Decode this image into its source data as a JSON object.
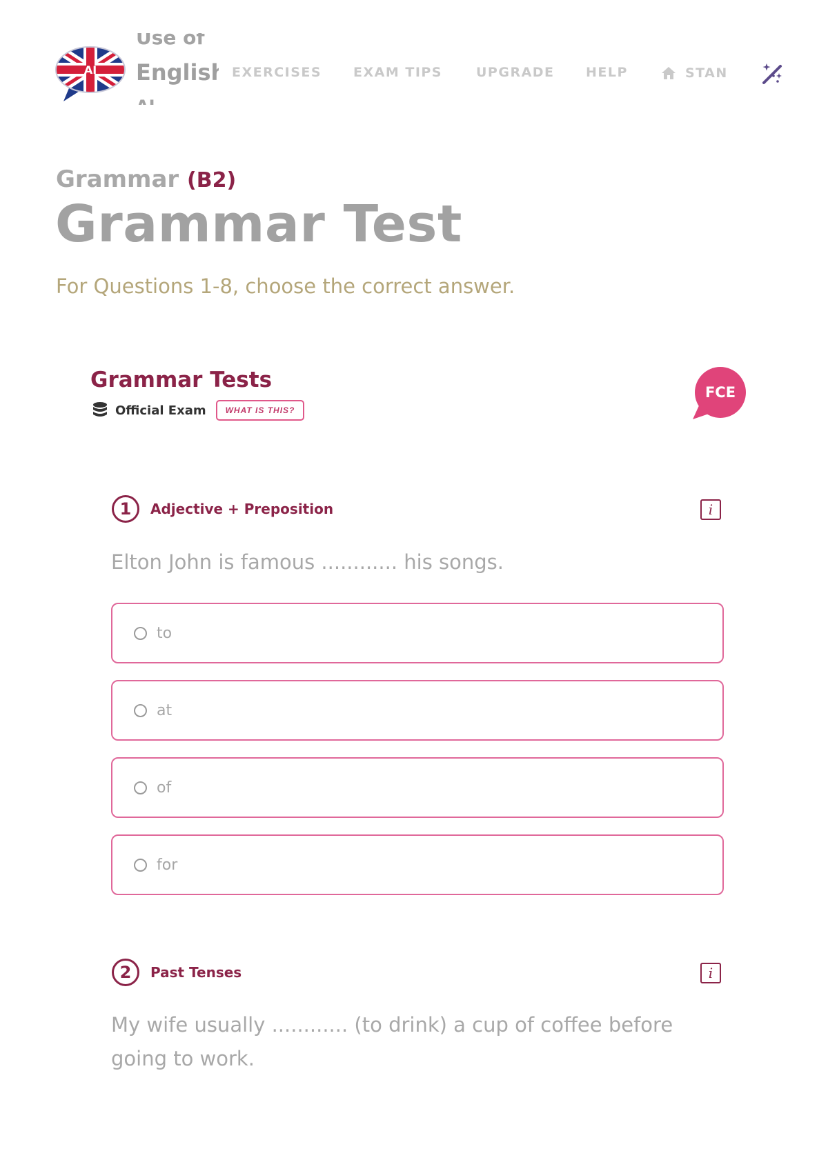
{
  "header": {
    "brand": {
      "line1": "Use of",
      "line2": "English",
      "line3": "AI",
      "flag_text": "AI"
    },
    "nav": [
      {
        "label": "EXERCISES"
      },
      {
        "label": "EXAM TIPS"
      },
      {
        "label": "UPGRADE"
      },
      {
        "label": "HELP"
      },
      {
        "label": "STAN",
        "icon": "home-icon"
      }
    ],
    "tools_icon": "magic-wand-icon"
  },
  "page": {
    "category": "Grammar",
    "level": "(B2)",
    "title": "Grammar Test",
    "instruction": "For Questions 1-8, choose the correct answer."
  },
  "test": {
    "heading": "Grammar Tests",
    "source_icon": "database-icon",
    "source_label": "Official Exam",
    "what_button": "WHAT IS THIS?",
    "badge": "FCE"
  },
  "questions": [
    {
      "number": "1",
      "topic": "Adjective + Preposition",
      "info": "i",
      "text": "Elton John is famous ............ his songs.",
      "options": [
        "to",
        "at",
        "of",
        "for"
      ]
    },
    {
      "number": "2",
      "topic": "Past Tenses",
      "info": "i",
      "text": "My wife usually ............ (to drink) a cup of coffee before going to work."
    }
  ],
  "colors": {
    "brand": "#8b2348",
    "accent_pink": "#e0689a",
    "badge_pink": "#e0447a",
    "instruction": "#b4a67a",
    "nav": "#c9c9c9"
  }
}
